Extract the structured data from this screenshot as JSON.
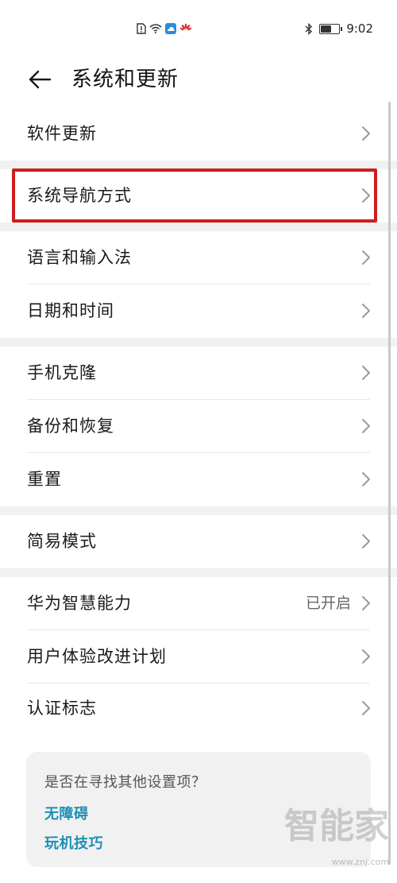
{
  "status_bar": {
    "time": "9:02",
    "icons": [
      "sim-alert-icon",
      "wifi-icon",
      "cloud-icon",
      "huawei-logo-icon",
      "bluetooth-icon",
      "battery-icon"
    ],
    "battery_level": 0.6
  },
  "header": {
    "title": "系统和更新",
    "back_icon": "arrow-left-icon"
  },
  "groups": [
    {
      "items": [
        {
          "id": "software-update",
          "label": "软件更新"
        }
      ]
    },
    {
      "items": [
        {
          "id": "navigation",
          "label": "系统导航方式",
          "highlighted": true
        }
      ]
    },
    {
      "items": [
        {
          "id": "language-input",
          "label": "语言和输入法"
        },
        {
          "id": "date-time",
          "label": "日期和时间"
        }
      ]
    },
    {
      "items": [
        {
          "id": "phone-clone",
          "label": "手机克隆"
        },
        {
          "id": "backup-restore",
          "label": "备份和恢复"
        },
        {
          "id": "reset",
          "label": "重置"
        }
      ]
    },
    {
      "items": [
        {
          "id": "simple-mode",
          "label": "简易模式"
        }
      ]
    },
    {
      "items": [
        {
          "id": "huawei-ai",
          "label": "华为智慧能力",
          "value": "已开启"
        },
        {
          "id": "ux-plan",
          "label": "用户体验改进计划"
        },
        {
          "id": "certification",
          "label": "认证标志"
        }
      ]
    }
  ],
  "suggestions": {
    "title": "是否在寻找其他设置项？",
    "links": [
      "无障碍",
      "玩机技巧"
    ]
  },
  "watermark": {
    "big": "智能家",
    "small": "www.znj.com"
  },
  "colors": {
    "highlight": "#cc1e1e",
    "link": "#1e8fb3",
    "gap": "#f1f1f1"
  }
}
